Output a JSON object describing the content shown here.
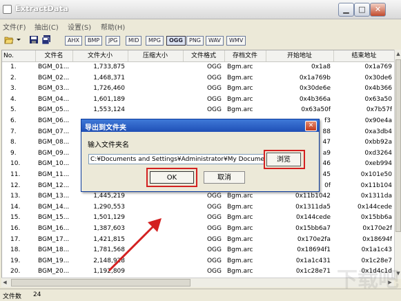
{
  "window": {
    "title": "ExtractData",
    "min_label": "▁",
    "max_label": "□",
    "close_label": "✕"
  },
  "menu": [
    "文件(F)",
    "抽出(C)",
    "设置(S)",
    "帮助(H)"
  ],
  "formats": [
    "AHX",
    "BMP",
    "JPG",
    "MID",
    "MPG",
    "OGG",
    "PNG",
    "WAV",
    "WMV"
  ],
  "active_format": "OGG",
  "columns": [
    "No.",
    "文件名",
    "文件大小",
    "压缩大小",
    "文件格式",
    "存档文件",
    "开始地址",
    "结束地址"
  ],
  "rows": [
    [
      "1.",
      "BGM_01...",
      "1,733,875",
      "",
      "OGG",
      "Bgm.arc",
      "0x1a8",
      "0x1a769"
    ],
    [
      "2.",
      "BGM_02...",
      "1,468,371",
      "",
      "OGG",
      "Bgm.arc",
      "0x1a769b",
      "0x30de6"
    ],
    [
      "3.",
      "BGM_03...",
      "1,726,460",
      "",
      "OGG",
      "Bgm.arc",
      "0x30de6e",
      "0x4b366"
    ],
    [
      "4.",
      "BGM_04...",
      "1,601,189",
      "",
      "OGG",
      "Bgm.arc",
      "0x4b366a",
      "0x63a50"
    ],
    [
      "5.",
      "BGM_05...",
      "1,553,124",
      "",
      "OGG",
      "Bgm.arc",
      "0x63a50f",
      "0x7b57f"
    ],
    [
      "6.",
      "BGM_06...",
      "",
      "",
      "",
      "",
      "f3",
      "0x90e4a"
    ],
    [
      "7.",
      "BGM_07...",
      "",
      "",
      "",
      "",
      "88",
      "0xa3db4"
    ],
    [
      "8.",
      "BGM_08...",
      "",
      "",
      "",
      "",
      "47",
      "0xbb92a"
    ],
    [
      "9.",
      "BGM_09...",
      "",
      "",
      "",
      "",
      "a9",
      "0xd3264"
    ],
    [
      "10.",
      "BGM_10...",
      "",
      "",
      "",
      "",
      "46",
      "0xeb994"
    ],
    [
      "11.",
      "BGM_11...",
      "",
      "",
      "",
      "",
      "45",
      "0x101e50"
    ],
    [
      "12.",
      "BGM_12...",
      "",
      "",
      "",
      "",
      "0f",
      "0x11b104"
    ],
    [
      "13.",
      "BGM_13...",
      "1,445,219",
      "",
      "OGG",
      "Bgm.arc",
      "0x11b1042",
      "0x1311da"
    ],
    [
      "14.",
      "BGM_14...",
      "1,290,553",
      "",
      "OGG",
      "Bgm.arc",
      "0x1311da5",
      "0x144cede"
    ],
    [
      "15.",
      "BGM_15...",
      "1,501,129",
      "",
      "OGG",
      "Bgm.arc",
      "0x144cede",
      "0x15bb6a"
    ],
    [
      "16.",
      "BGM_16...",
      "1,387,603",
      "",
      "OGG",
      "Bgm.arc",
      "0x15bb6a7",
      "0x170e2f"
    ],
    [
      "17.",
      "BGM_17...",
      "1,421,815",
      "",
      "OGG",
      "Bgm.arc",
      "0x170e2fa",
      "0x18694f"
    ],
    [
      "18.",
      "BGM_18...",
      "1,781,568",
      "",
      "OGG",
      "Bgm.arc",
      "0x18694f1",
      "0x1a1c43"
    ],
    [
      "19.",
      "BGM_19...",
      "2,148,928",
      "",
      "OGG",
      "Bgm.arc",
      "0x1a1c431",
      "0x1c28e7"
    ],
    [
      "20.",
      "BGM_20...",
      "1,192,809",
      "",
      "OGG",
      "Bgm.arc",
      "0x1c28e71",
      "0x1d4c1d"
    ]
  ],
  "status": {
    "label": "文件数",
    "value": "24"
  },
  "dialog": {
    "title": "导出到文件夹",
    "label": "输入文件夹名",
    "path": "C:¥Documents and Settings¥Administrator¥My Documents",
    "browse": "浏览",
    "ok": "OK",
    "cancel": "取消",
    "close_label": "✕"
  },
  "watermark": "下载吧"
}
